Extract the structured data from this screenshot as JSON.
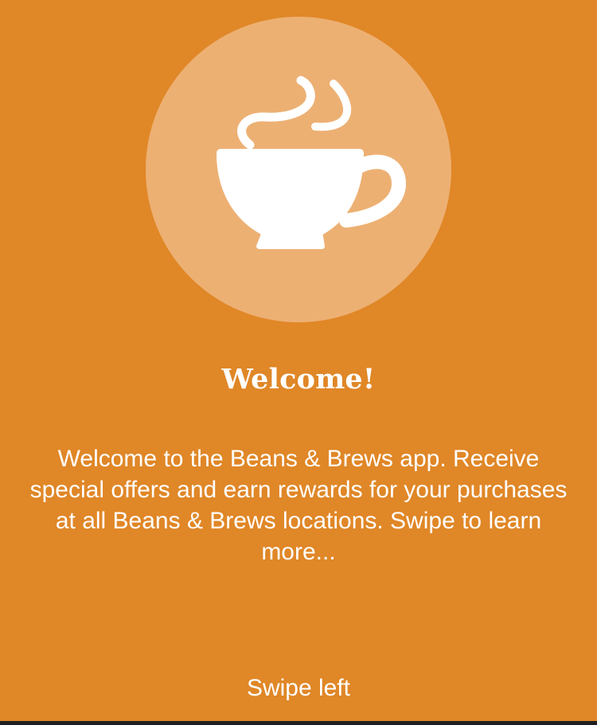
{
  "theme": {
    "background": "#e08727",
    "circle": "#edb073",
    "text": "#ffffff"
  },
  "hero": {
    "icon": "coffee-cup-icon"
  },
  "welcome": {
    "title": "Welcome!",
    "description": "Welcome to the Beans & Brews app. Receive special offers and earn rewards for your purchases at all Beans & Brews locations. Swipe to learn more..."
  },
  "footer": {
    "swipe_hint": "Swipe left"
  }
}
